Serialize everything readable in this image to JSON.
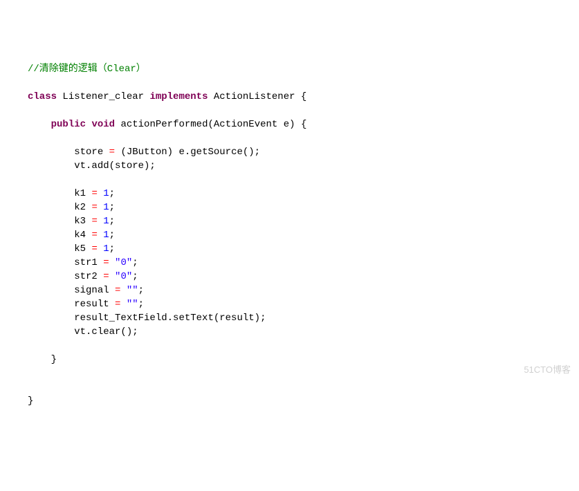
{
  "code": {
    "comment": "//清除键的逻辑（Clear）",
    "classKw": "class",
    "className": "Listener_clear",
    "implementsKw": "implements",
    "iface": "ActionListener",
    "open": "{",
    "close": "}",
    "publicKw": "public",
    "voidKw": "void",
    "method": "actionPerformed",
    "paramType": "ActionEvent",
    "paramName": "e",
    "body": {
      "l1a": "store",
      "l1b": "(JButton) e.getSource();",
      "l2": "vt.add(store);",
      "k1": "k1",
      "k2": "k2",
      "k3": "k3",
      "k4": "k4",
      "k5": "k5",
      "one": "1",
      "semi": ";",
      "eq": "=",
      "str1": "str1",
      "str2": "str2",
      "signal": "signal",
      "result": "result",
      "sZero": "\"0\"",
      "sEmpty": "\"\"",
      "setText": "result_TextField.setText(result);",
      "vtclear": "vt.clear();"
    }
  },
  "watermark": "51CTO博客"
}
